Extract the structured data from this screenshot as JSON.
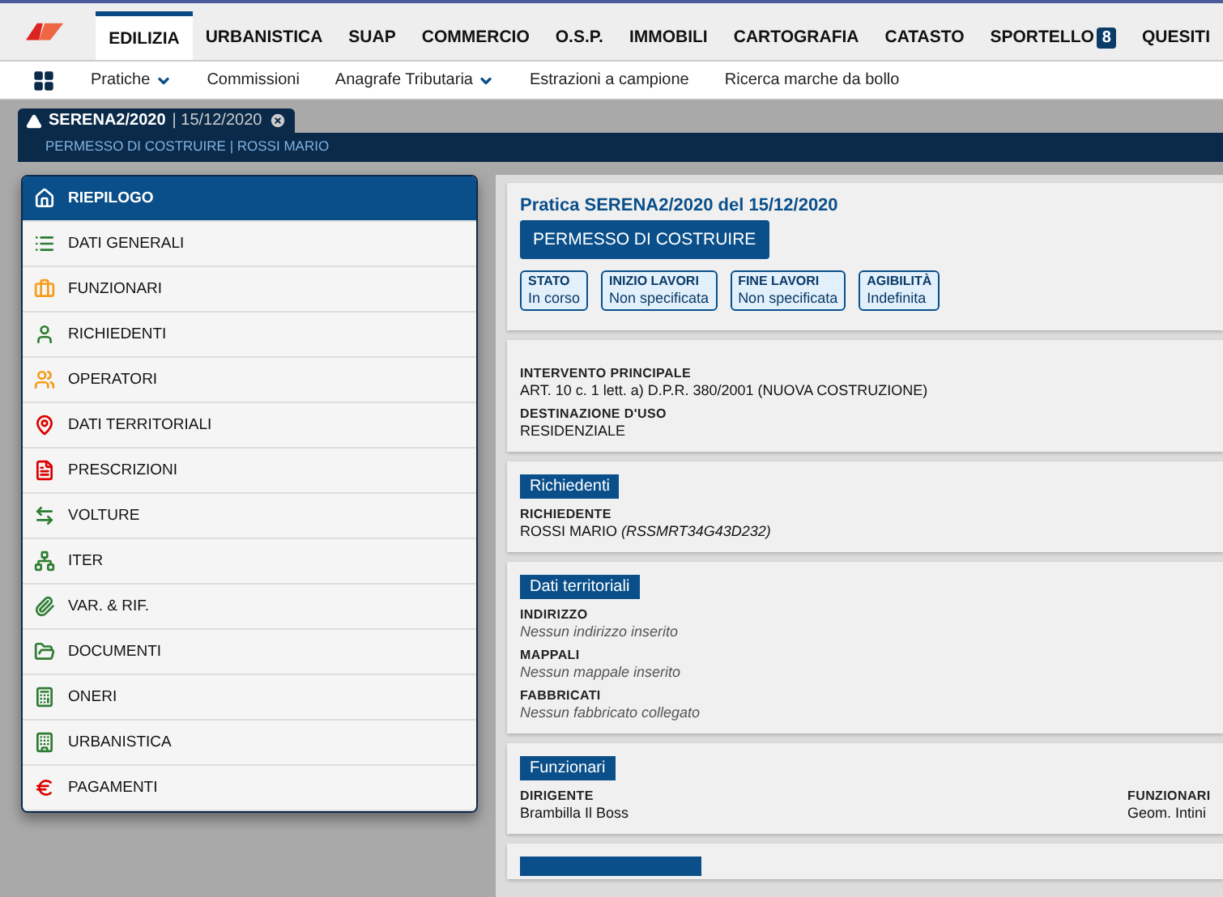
{
  "nav": {
    "tabs": [
      {
        "label": "EDILIZIA",
        "selected": true
      },
      {
        "label": "URBANISTICA",
        "selected": false
      },
      {
        "label": "SUAP",
        "selected": false
      },
      {
        "label": "COMMERCIO",
        "selected": false
      },
      {
        "label": "O.S.P.",
        "selected": false
      },
      {
        "label": "IMMOBILI",
        "selected": false
      },
      {
        "label": "CARTOGRAFIA",
        "selected": false
      },
      {
        "label": "CATASTO",
        "selected": false
      },
      {
        "label": "SPORTELLO",
        "selected": false,
        "badge": "8"
      },
      {
        "label": "QUESITI",
        "selected": false
      }
    ]
  },
  "subnav": [
    {
      "label": "Pratiche",
      "dropdown": true
    },
    {
      "label": "Commissioni",
      "dropdown": false
    },
    {
      "label": "Anagrafe Tributaria",
      "dropdown": true
    },
    {
      "label": "Estrazioni a campione",
      "dropdown": false
    },
    {
      "label": "Ricerca marche da bollo",
      "dropdown": false
    }
  ],
  "document_tab": {
    "code": "SERENA2/2020",
    "separator": "|",
    "date": "15/12/2020",
    "subtitle": "PERMESSO DI COSTRUIRE | ROSSI MARIO"
  },
  "sidebar": {
    "items": [
      {
        "label": "RIEPILOGO",
        "selected": true
      },
      {
        "label": "DATI GENERALI",
        "selected": false
      },
      {
        "label": "FUNZIONARI",
        "selected": false
      },
      {
        "label": "RICHIEDENTI",
        "selected": false
      },
      {
        "label": "OPERATORI",
        "selected": false
      },
      {
        "label": "DATI TERRITORIALI",
        "selected": false
      },
      {
        "label": "PRESCRIZIONI",
        "selected": false
      },
      {
        "label": "VOLTURE",
        "selected": false
      },
      {
        "label": "ITER",
        "selected": false
      },
      {
        "label": "VAR. & RIF.",
        "selected": false
      },
      {
        "label": "DOCUMENTI",
        "selected": false
      },
      {
        "label": "ONERI",
        "selected": false
      },
      {
        "label": "URBANISTICA",
        "selected": false
      },
      {
        "label": "PAGAMENTI",
        "selected": false
      }
    ]
  },
  "summary": {
    "title": "Pratica SERENA2/2020 del 15/12/2020",
    "type_button": "PERMESSO DI COSTRUIRE",
    "badges": [
      {
        "label": "STATO",
        "value": "In corso"
      },
      {
        "label": "INIZIO LAVORI",
        "value": "Non specificata"
      },
      {
        "label": "FINE LAVORI",
        "value": "Non specificata"
      },
      {
        "label": "AGIBILITÀ",
        "value": "Indefinita"
      }
    ]
  },
  "sections": [
    {
      "columns": [
        [
          {
            "label": "INTERVENTO PRINCIPALE",
            "value": "ART. 10 c. 1 lett. a) D.P.R. 380/2001 (NUOVA COSTRUZIONE)",
            "empty": false
          },
          {
            "label": "DESTINAZIONE D'USO",
            "value": "RESIDENZIALE",
            "empty": false
          }
        ]
      ]
    },
    {
      "heading": "Richiedenti",
      "columns": [
        [
          {
            "label": "RICHIEDENTE",
            "value": "ROSSI MARIO *(RSSMRT34G43D232)*",
            "empty": false
          }
        ]
      ]
    },
    {
      "heading": "Dati territoriali",
      "columns": [
        [
          {
            "label": "INDIRIZZO",
            "value": "Nessun indirizzo inserito",
            "empty": true
          },
          {
            "label": "MAPPALI",
            "value": "Nessun mappale inserito",
            "empty": true
          },
          {
            "label": "FABBRICATI",
            "value": "Nessun fabbricato collegato",
            "empty": true
          }
        ]
      ]
    },
    {
      "heading": "Funzionari",
      "columns": [
        [
          {
            "label": "DIRIGENTE",
            "value": "Brambilla Il Boss",
            "empty": false
          }
        ],
        [
          {
            "label": "FUNZIONARI",
            "value": "Geom. Intini",
            "empty": false
          }
        ]
      ]
    }
  ]
}
